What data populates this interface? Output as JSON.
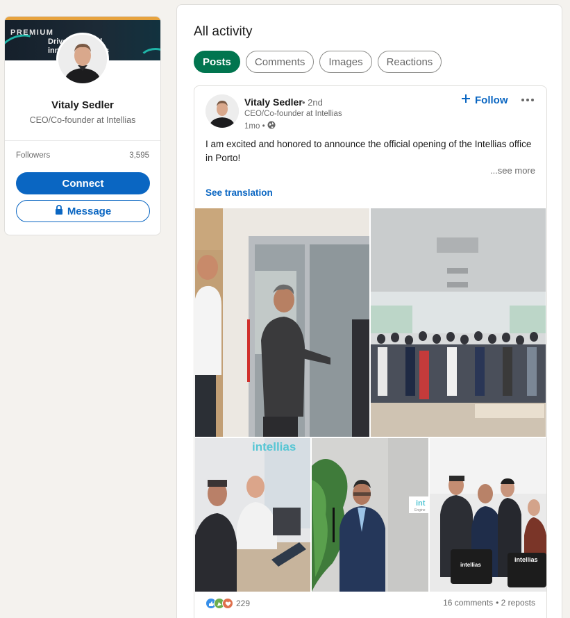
{
  "profile": {
    "banner_label": "PREMIUM",
    "banner_line1": "Drive   ence and",
    "banner_line2": "inn          our business",
    "name": "Vitaly Sedler",
    "headline": "CEO/Co-founder at Intellias",
    "followers_label": "Followers",
    "followers_count": "3,595",
    "connect_label": "Connect",
    "message_label": "Message"
  },
  "activity": {
    "title": "All activity",
    "tabs": [
      {
        "label": "Posts",
        "active": true
      },
      {
        "label": "Comments",
        "active": false
      },
      {
        "label": "Images",
        "active": false
      },
      {
        "label": "Reactions",
        "active": false
      }
    ]
  },
  "post": {
    "author_name": "Vitaly Sedler",
    "degree": "• 2nd",
    "author_headline": "CEO/Co-founder at Intellias",
    "time": "1mo •",
    "follow_label": "Follow",
    "text": "I am excited and honored to announce the official opening of the Intellias office in Porto!",
    "see_more": "...see more",
    "see_translation": "See translation",
    "photo_brand_text": "intellias",
    "photo_partial_text": "int",
    "photo_partial_text2": "Engine",
    "reaction_count": "229",
    "comments": "16 comments",
    "reposts": "• 2 reposts"
  },
  "colors": {
    "accent_blue": "#0a66c2",
    "active_pill_green": "#01754f",
    "premium_gold": "#e7a33e"
  },
  "icons": {
    "follow": "plus-icon",
    "more": "ellipsis-icon",
    "visibility": "globe-icon",
    "message": "lock-icon"
  }
}
